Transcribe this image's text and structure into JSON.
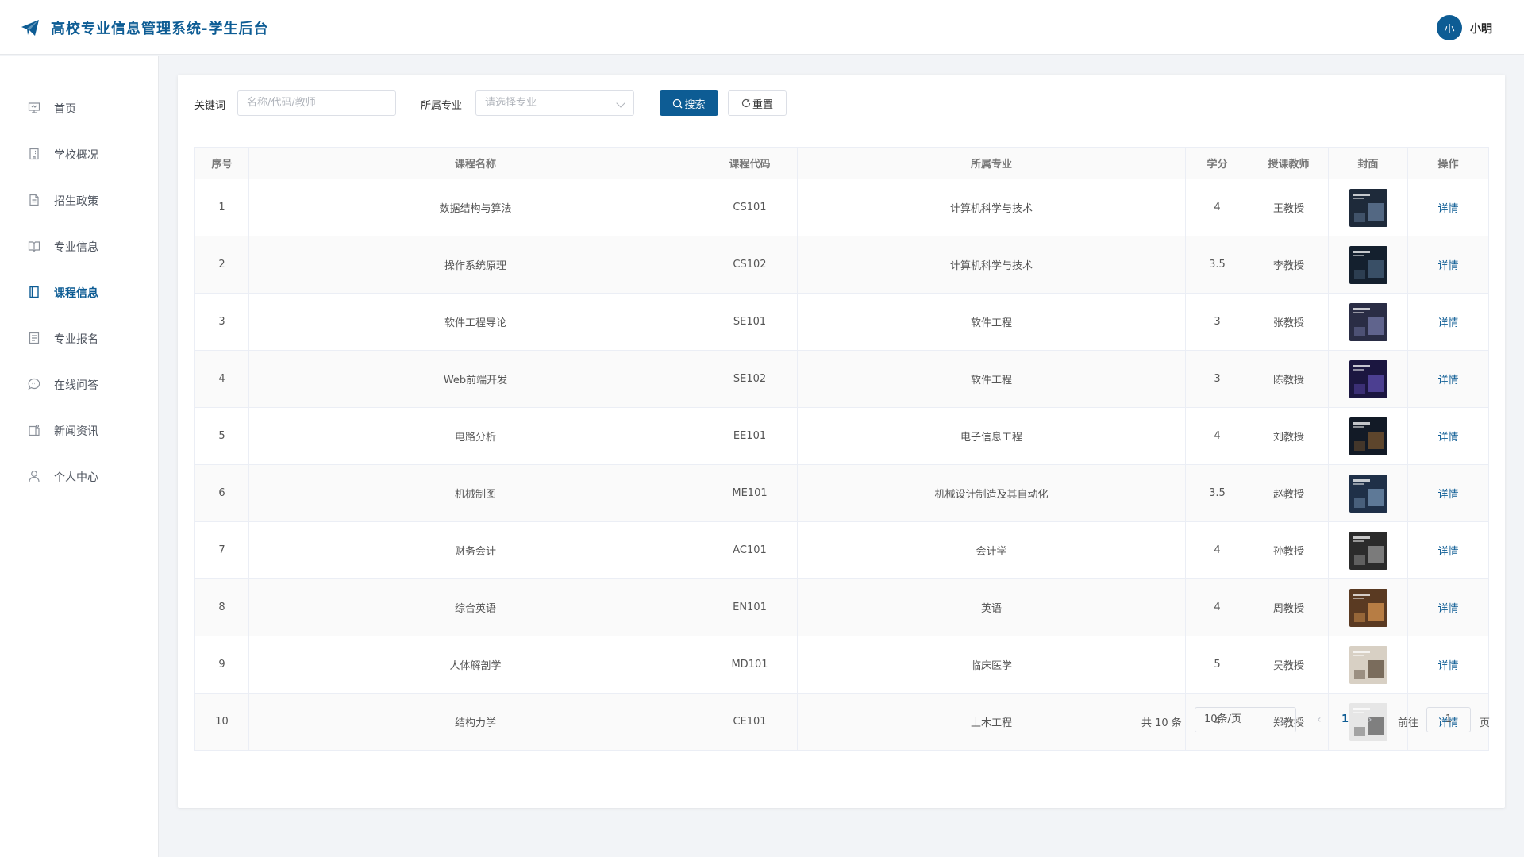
{
  "header": {
    "title": "高校专业信息管理系统-学生后台",
    "avatar_text": "小",
    "username": "小明"
  },
  "sidebar": {
    "items": [
      {
        "label": "首页",
        "icon": "presentation-icon"
      },
      {
        "label": "学校概况",
        "icon": "building-icon"
      },
      {
        "label": "招生政策",
        "icon": "document-icon"
      },
      {
        "label": "专业信息",
        "icon": "book-open-icon"
      },
      {
        "label": "课程信息",
        "icon": "book-icon",
        "active": true
      },
      {
        "label": "专业报名",
        "icon": "form-icon"
      },
      {
        "label": "在线问答",
        "icon": "chat-icon"
      },
      {
        "label": "新闻资讯",
        "icon": "news-icon"
      },
      {
        "label": "个人中心",
        "icon": "user-icon"
      }
    ]
  },
  "filters": {
    "keyword_label": "关键词",
    "keyword_placeholder": "名称/代码/教师",
    "major_label": "所属专业",
    "major_placeholder": "请选择专业",
    "search_label": "搜索",
    "reset_label": "重置"
  },
  "table": {
    "columns": [
      "序号",
      "课程名称",
      "课程代码",
      "所属专业",
      "学分",
      "授课教师",
      "封面",
      "操作"
    ],
    "rows": [
      {
        "no": "1",
        "name": "数据结构与算法",
        "code": "CS101",
        "major": "计算机科学与技术",
        "credit": "4",
        "teacher": "王教授",
        "action": "详情"
      },
      {
        "no": "2",
        "name": "操作系统原理",
        "code": "CS102",
        "major": "计算机科学与技术",
        "credit": "3.5",
        "teacher": "李教授",
        "action": "详情"
      },
      {
        "no": "3",
        "name": "软件工程导论",
        "code": "SE101",
        "major": "软件工程",
        "credit": "3",
        "teacher": "张教授",
        "action": "详情"
      },
      {
        "no": "4",
        "name": "Web前端开发",
        "code": "SE102",
        "major": "软件工程",
        "credit": "3",
        "teacher": "陈教授",
        "action": "详情"
      },
      {
        "no": "5",
        "name": "电路分析",
        "code": "EE101",
        "major": "电子信息工程",
        "credit": "4",
        "teacher": "刘教授",
        "action": "详情"
      },
      {
        "no": "6",
        "name": "机械制图",
        "code": "ME101",
        "major": "机械设计制造及其自动化",
        "credit": "3.5",
        "teacher": "赵教授",
        "action": "详情"
      },
      {
        "no": "7",
        "name": "财务会计",
        "code": "AC101",
        "major": "会计学",
        "credit": "4",
        "teacher": "孙教授",
        "action": "详情"
      },
      {
        "no": "8",
        "name": "综合英语",
        "code": "EN101",
        "major": "英语",
        "credit": "4",
        "teacher": "周教授",
        "action": "详情"
      },
      {
        "no": "9",
        "name": "人体解剖学",
        "code": "MD101",
        "major": "临床医学",
        "credit": "5",
        "teacher": "吴教授",
        "action": "详情"
      },
      {
        "no": "10",
        "name": "结构力学",
        "code": "CE101",
        "major": "土木工程",
        "credit": "4",
        "teacher": "郑教授",
        "action": "详情"
      }
    ]
  },
  "pagination": {
    "total": "共 10 条",
    "page_size": "10条/页",
    "current_page": "1",
    "goto_label": "前往",
    "goto_value": "1",
    "goto_unit": "页"
  },
  "colors": {
    "accent": "#0d5c94",
    "background": "#f2f4f7"
  }
}
